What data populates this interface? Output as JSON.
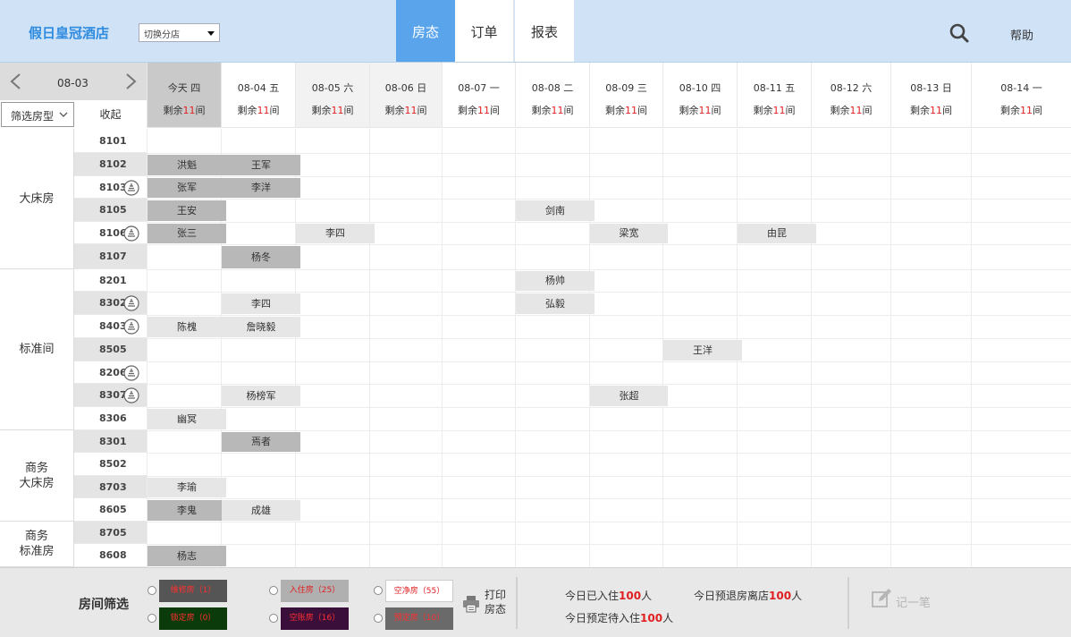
{
  "header": {
    "hotel_name": "假日皇冠酒店",
    "branch_select": "切换分店",
    "tabs": [
      "房态",
      "订单",
      "报表"
    ],
    "active_tab": "房态",
    "help": "帮助"
  },
  "date_nav": {
    "current": "08-03"
  },
  "table_head": {
    "room_type_filter": "筛选房型",
    "fold_label": "收起"
  },
  "days": [
    {
      "date": "今天 四",
      "remain_prefix": "剩余",
      "remain_num": "11",
      "remain_suffix": "间",
      "style": "today"
    },
    {
      "date": "08-04 五",
      "remain_prefix": "剩余",
      "remain_num": "11",
      "remain_suffix": "间",
      "style": "normal"
    },
    {
      "date": "08-05 六",
      "remain_prefix": "剩余",
      "remain_num": "11",
      "remain_suffix": "间",
      "style": "weekend"
    },
    {
      "date": "08-06 日",
      "remain_prefix": "剩余",
      "remain_num": "11",
      "remain_suffix": "间",
      "style": "weekend"
    },
    {
      "date": "08-07 一",
      "remain_prefix": "剩余",
      "remain_num": "11",
      "remain_suffix": "间",
      "style": "normal"
    },
    {
      "date": "08-08 二",
      "remain_prefix": "剩余",
      "remain_num": "11",
      "remain_suffix": "间",
      "style": "normal"
    },
    {
      "date": "08-09 三",
      "remain_prefix": "剩余",
      "remain_num": "11",
      "remain_suffix": "间",
      "style": "normal"
    },
    {
      "date": "08-10 四",
      "remain_prefix": "剩余",
      "remain_num": "11",
      "remain_suffix": "间",
      "style": "normal"
    },
    {
      "date": "08-11 五",
      "remain_prefix": "剩余",
      "remain_num": "11",
      "remain_suffix": "间",
      "style": "normal"
    },
    {
      "date": "08-12 六",
      "remain_prefix": "剩余",
      "remain_num": "11",
      "remain_suffix": "间",
      "style": "normal"
    },
    {
      "date": "08-13 日",
      "remain_prefix": "剩余",
      "remain_num": "11",
      "remain_suffix": "间",
      "style": "normal"
    },
    {
      "date": "08-14 一",
      "remain_prefix": "剩余",
      "remain_num": "11",
      "remain_suffix": "间",
      "style": "normal"
    }
  ],
  "room_types": [
    {
      "name": "大床房",
      "rows": 6
    },
    {
      "name": "标准间",
      "rows": 7
    },
    {
      "name": "商务\n大床房",
      "rows": 4
    },
    {
      "name": "商务\n标准房",
      "rows": 2
    }
  ],
  "rooms": [
    {
      "number": "8101",
      "clean_icon": false
    },
    {
      "number": "8102",
      "clean_icon": false
    },
    {
      "number": "8103",
      "clean_icon": true
    },
    {
      "number": "8105",
      "clean_icon": false
    },
    {
      "number": "8106",
      "clean_icon": true
    },
    {
      "number": "8107",
      "clean_icon": false
    },
    {
      "number": "8201",
      "clean_icon": false
    },
    {
      "number": "8302",
      "clean_icon": true
    },
    {
      "number": "8403",
      "clean_icon": true
    },
    {
      "number": "8505",
      "clean_icon": false
    },
    {
      "number": "8206",
      "clean_icon": true
    },
    {
      "number": "8307",
      "clean_icon": true
    },
    {
      "number": "8306",
      "clean_icon": false
    },
    {
      "number": "8301",
      "clean_icon": false
    },
    {
      "number": "8502",
      "clean_icon": false
    },
    {
      "number": "8703",
      "clean_icon": false
    },
    {
      "number": "8605",
      "clean_icon": false
    },
    {
      "number": "8705",
      "clean_icon": false
    },
    {
      "number": "8608",
      "clean_icon": false
    }
  ],
  "bookings": [
    {
      "room": 1,
      "day": 0,
      "guest": "洪魁",
      "tone": "dark"
    },
    {
      "room": 1,
      "day": 1,
      "guest": "王军",
      "tone": "dark"
    },
    {
      "room": 2,
      "day": 0,
      "guest": "张军",
      "tone": "dark"
    },
    {
      "room": 2,
      "day": 1,
      "guest": "李洋",
      "tone": "dark"
    },
    {
      "room": 3,
      "day": 0,
      "guest": "王安",
      "tone": "dark"
    },
    {
      "room": 3,
      "day": 5,
      "guest": "剑南",
      "tone": "light"
    },
    {
      "room": 4,
      "day": 0,
      "guest": "张三",
      "tone": "dark"
    },
    {
      "room": 4,
      "day": 2,
      "guest": "李四",
      "tone": "light"
    },
    {
      "room": 4,
      "day": 6,
      "guest": "梁宽",
      "tone": "light"
    },
    {
      "room": 4,
      "day": 8,
      "guest": "由昆",
      "tone": "light"
    },
    {
      "room": 5,
      "day": 1,
      "guest": "杨冬",
      "tone": "dark"
    },
    {
      "room": 6,
      "day": 5,
      "guest": "杨帅",
      "tone": "light"
    },
    {
      "room": 7,
      "day": 1,
      "guest": "李四",
      "tone": "light"
    },
    {
      "room": 7,
      "day": 5,
      "guest": "弘毅",
      "tone": "light"
    },
    {
      "room": 8,
      "day": 0,
      "guest": "陈槐",
      "tone": "light"
    },
    {
      "room": 8,
      "day": 1,
      "guest": "詹晓毅",
      "tone": "light"
    },
    {
      "room": 9,
      "day": 7,
      "guest": "王洋",
      "tone": "light"
    },
    {
      "room": 11,
      "day": 1,
      "guest": "杨榜军",
      "tone": "light"
    },
    {
      "room": 11,
      "day": 6,
      "guest": "张超",
      "tone": "light"
    },
    {
      "room": 12,
      "day": 0,
      "guest": "幽冥",
      "tone": "light"
    },
    {
      "room": 13,
      "day": 1,
      "guest": "焉者",
      "tone": "dark"
    },
    {
      "room": 15,
      "day": 0,
      "guest": "李瑜",
      "tone": "light"
    },
    {
      "room": 16,
      "day": 0,
      "guest": "李鬼",
      "tone": "dark"
    },
    {
      "room": 16,
      "day": 1,
      "guest": "成雄",
      "tone": "light"
    },
    {
      "room": 18,
      "day": 0,
      "guest": "杨志",
      "tone": "dark"
    }
  ],
  "footer": {
    "filter_title": "房间筛选",
    "legend": [
      {
        "label": "维修房（1）",
        "bg": "#555555",
        "fg": "#ff3030"
      },
      {
        "label": "锁定房（0）",
        "bg": "#0b3a0b",
        "fg": "#ff3030"
      },
      {
        "label": "入住房（25）",
        "bg": "#b0b0b0",
        "fg": "#e02020"
      },
      {
        "label": "空账房（16）",
        "bg": "#3a0f3a",
        "fg": "#ff3030"
      },
      {
        "label": "空净房（55）",
        "bg": "#ffffff",
        "fg": "#e02020"
      },
      {
        "label": "预定房（10）",
        "bg": "#6a6a6a",
        "fg": "#ff3030"
      }
    ],
    "print_label": "打印\n房态",
    "stats": [
      {
        "prefix": "今日已入住",
        "num": "100",
        "suffix": "人"
      },
      {
        "prefix": "今日预退房离店",
        "num": "100",
        "suffix": "人"
      },
      {
        "prefix": "今日预定待入住",
        "num": "100",
        "suffix": "人"
      }
    ],
    "note_label": "记一笔"
  }
}
